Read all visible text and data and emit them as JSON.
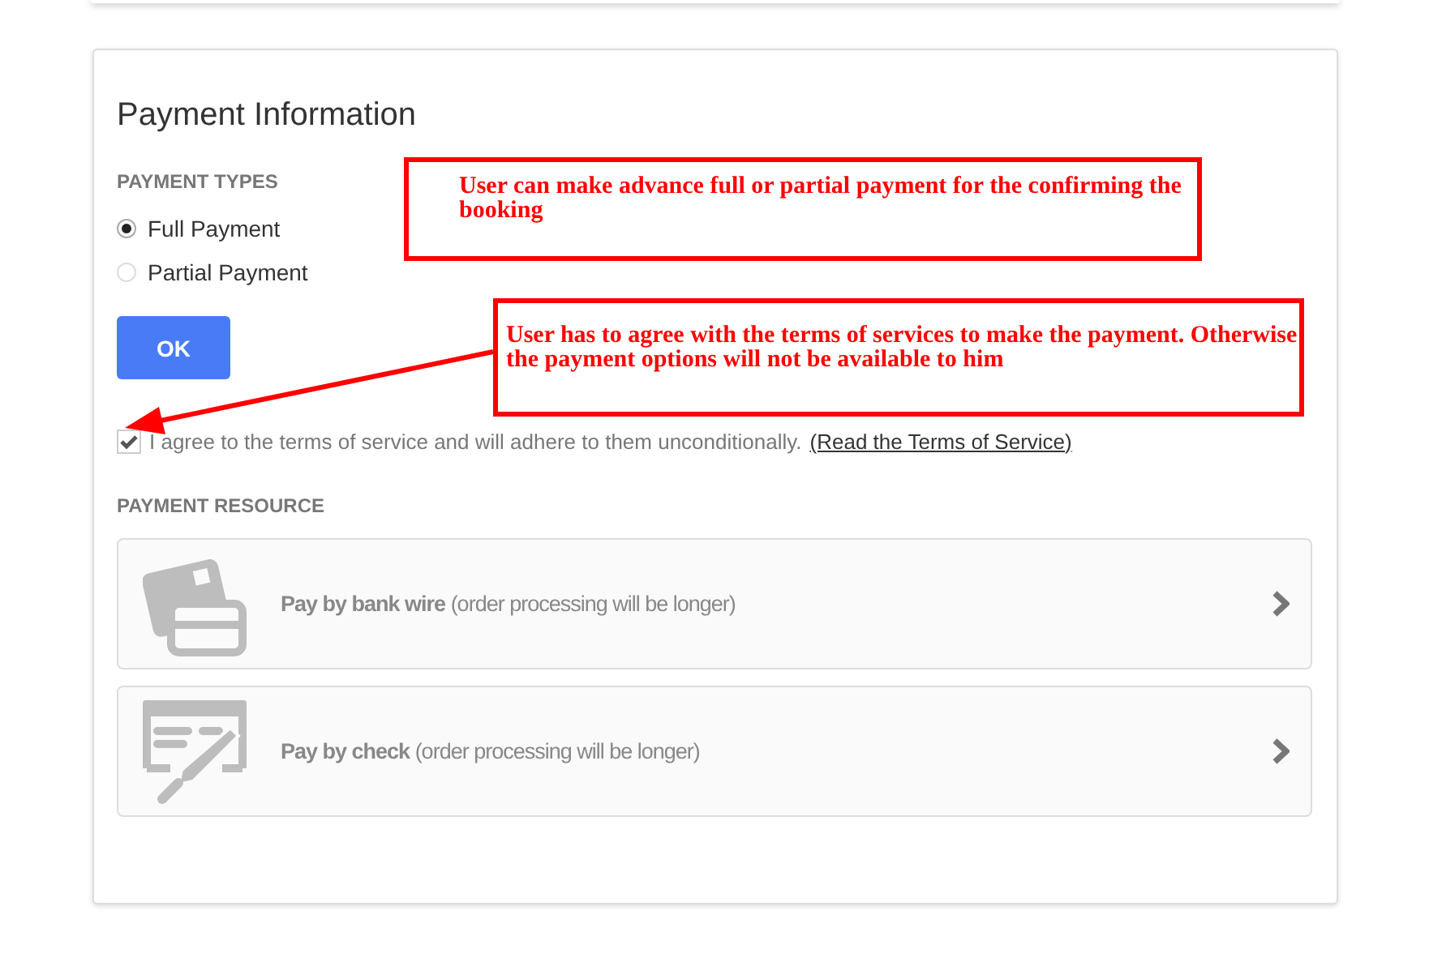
{
  "panel": {
    "title": "Payment Information"
  },
  "payment_types": {
    "heading": "PAYMENT TYPES",
    "options": [
      {
        "label": "Full Payment",
        "selected": true
      },
      {
        "label": "Partial Payment",
        "selected": false
      }
    ]
  },
  "ok_button": {
    "label": "OK"
  },
  "terms": {
    "checked": true,
    "text": "I agree to the terms of service and will adhere to them unconditionally.",
    "link": "(Read the Terms of Service)"
  },
  "payment_resource": {
    "heading": "PAYMENT RESOURCE",
    "methods": [
      {
        "kind": "bank-wire",
        "label": "**Pay by bank wire** (order processing will be longer)"
      },
      {
        "kind": "check",
        "label": "**Pay by check** (order processing will be longer)"
      }
    ]
  },
  "annotations": [
    {
      "text": "User can make advance full or partial payment for the confirming the booking",
      "arrow": false
    },
    {
      "text": "User has to agree with the terms of services to make the payment. Otherwise the payment options will not be available to him",
      "arrow": true
    }
  ]
}
